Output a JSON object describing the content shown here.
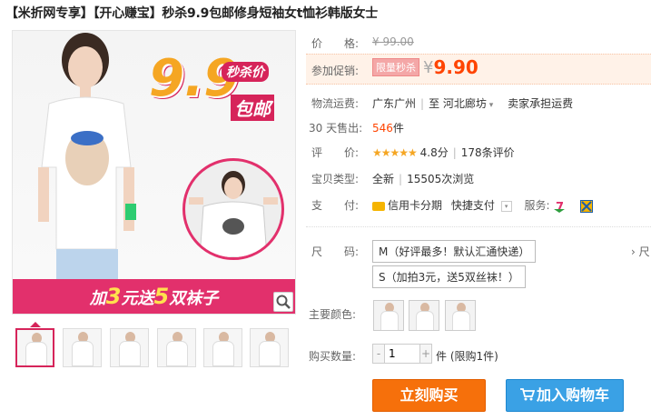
{
  "title": "【米折网专享】【开心赚宝】秒杀9.9包邮修身短袖女t恤衫韩版女士",
  "gallery": {
    "promo_nine": "9.9",
    "promo_miaosha": "秒杀价",
    "promo_baoyou": "包邮",
    "promo_bar_pre": "加",
    "promo_bar_3": "3",
    "promo_bar_mid": "元送",
    "promo_bar_5": "5",
    "promo_bar_post": "双袜子",
    "thumb_count": 6
  },
  "info": {
    "price_label": "价　　格:",
    "orig_price": "¥ 99.00",
    "promo_label": "参加促销:",
    "promo_tag": "限量秒杀",
    "yen": "¥",
    "promo_price": "9.90",
    "shipping_label": "物流运费:",
    "ship_from": "广东广州",
    "ship_to_prefix": "至",
    "ship_to": "河北廊坊",
    "ship_fee": "卖家承担运费",
    "sold_label": "30 天售出:",
    "sold_count": "546",
    "sold_unit": "件",
    "rating_label": "评　　价:",
    "stars": "★★★★★",
    "rating_score": "4.8分",
    "review_count": "178条评价",
    "type_label": "宝贝类型:",
    "type_value": "全新",
    "views": "15505次浏览",
    "pay_label": "支　　付:",
    "pay_credit": "信用卡分期",
    "pay_quick": "快捷支付",
    "service_label": "服务:"
  },
  "sku": {
    "size_label": "尺　　码:",
    "size_opt1": "M（好评最多！默认汇通快递）",
    "size_opt2": "S（加拍3元，送5双丝袜！）",
    "right_hint": "› 尺",
    "color_label": "主要颜色:",
    "qty_label": "购买数量:",
    "qty_value": "1",
    "qty_minus": "-",
    "qty_plus": "+",
    "qty_unit": "件 (限购1件)"
  },
  "actions": {
    "buy_now": "立刻购买",
    "add_cart": "加入购物车"
  },
  "colors": {
    "accent": "#d6245a",
    "price": "#ff4400",
    "buy": "#f6700b",
    "cart": "#3aa1e5"
  }
}
